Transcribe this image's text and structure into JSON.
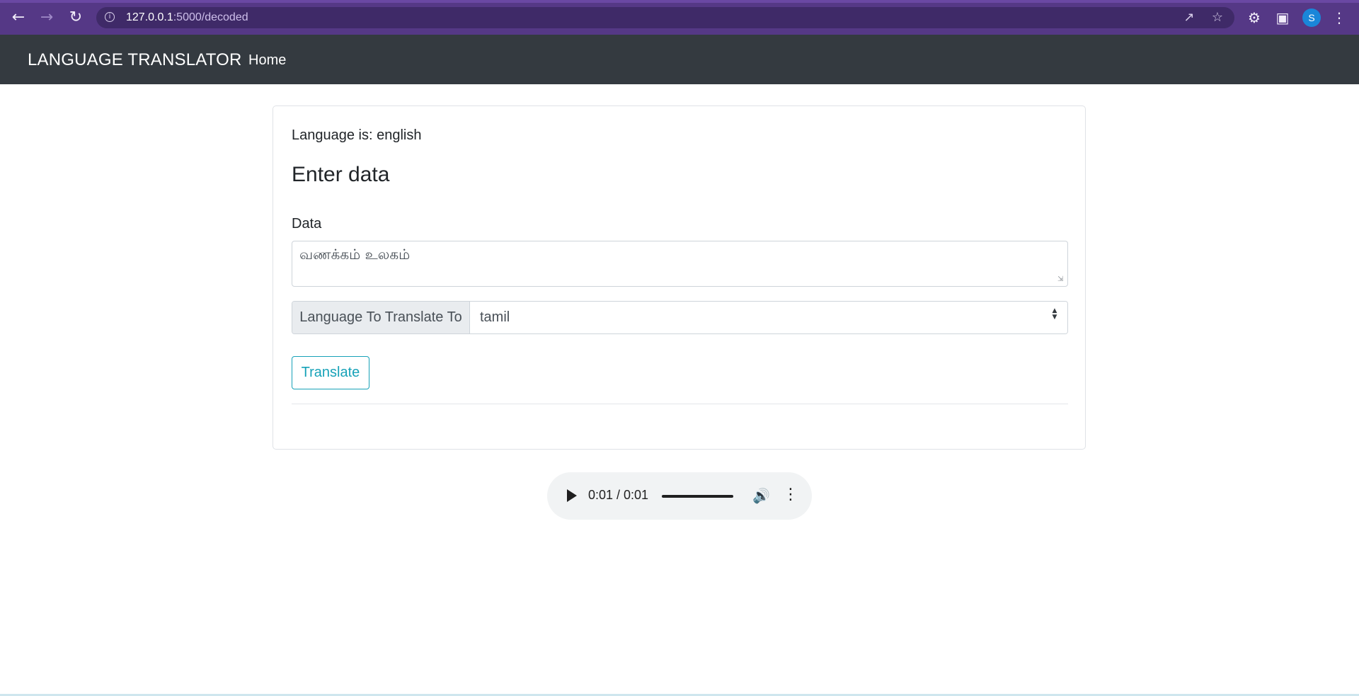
{
  "browser": {
    "url_host": "127.0.0.1",
    "url_path": ":5000/decoded",
    "profile_initial": "S",
    "icons": [
      "back-icon",
      "forward-icon",
      "reload-icon",
      "info-icon",
      "share-icon",
      "star-icon",
      "extensions-icon",
      "side-panel-icon",
      "kebab-menu-icon"
    ]
  },
  "navbar": {
    "brand": "LANGUAGE TRANSLATOR",
    "home": "Home"
  },
  "card": {
    "language_line": "Language is: english",
    "heading": "Enter data",
    "data_label": "Data",
    "data_value": "வணக்கம் உலகம்",
    "translate_prepend": "Language To Translate To",
    "selected_language": "tamil",
    "translate_button": "Translate"
  },
  "audio": {
    "time": "0:01 / 0:01",
    "progress": 1.0
  },
  "colors": {
    "browser_chrome": "#553886",
    "navbar": "#343a40",
    "accent_info": "#17a2b8"
  }
}
